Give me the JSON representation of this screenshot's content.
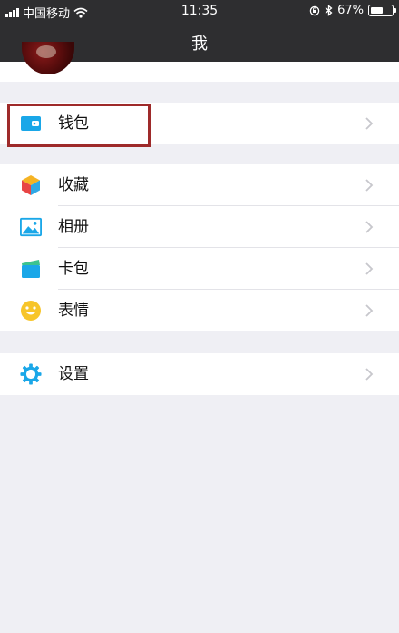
{
  "status_bar": {
    "carrier": "中国移动",
    "time": "11:35",
    "battery": "67%",
    "battery_level": 0.67
  },
  "nav": {
    "title": "我"
  },
  "groups": [
    {
      "items": [
        {
          "label": "钱包",
          "icon": "wallet-icon"
        }
      ]
    },
    {
      "items": [
        {
          "label": "收藏",
          "icon": "cube-icon"
        },
        {
          "label": "相册",
          "icon": "photo-icon"
        },
        {
          "label": "卡包",
          "icon": "card-icon"
        },
        {
          "label": "表情",
          "icon": "smiley-icon"
        }
      ]
    },
    {
      "items": [
        {
          "label": "设置",
          "icon": "gear-icon"
        }
      ]
    }
  ],
  "colors": {
    "header_bg": "#2e2e30",
    "page_bg": "#efeff4",
    "highlight": "#9e2a2a",
    "wallet_blue": "#1aa7e8"
  }
}
